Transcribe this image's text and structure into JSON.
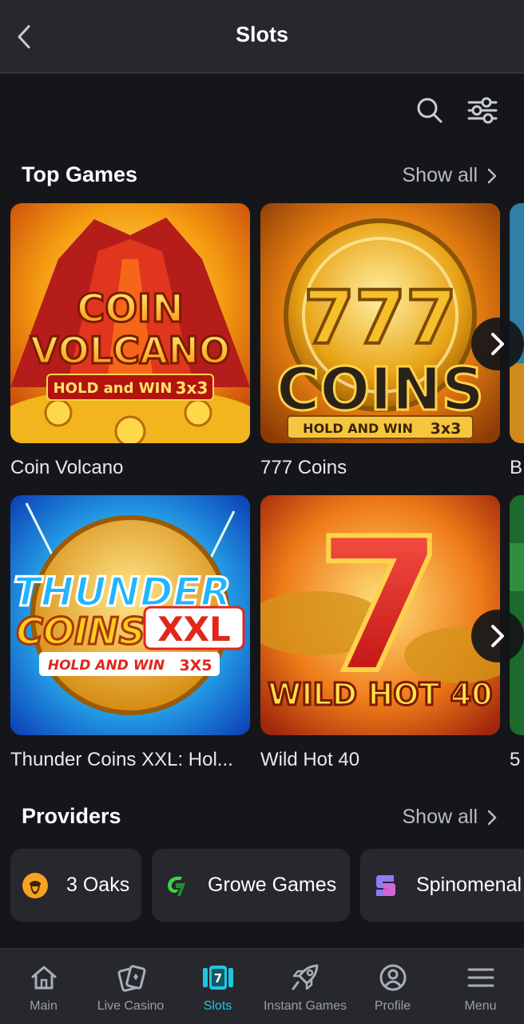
{
  "header": {
    "title": "Slots"
  },
  "top_games": {
    "title": "Top Games",
    "show_all": "Show all",
    "row1": [
      {
        "name": "Coin Volcano",
        "art_line1": "COIN",
        "art_line2": "VOLCANO",
        "art_line3": "HOLD and WIN",
        "art_badge": "3x3"
      },
      {
        "name": "777 Coins",
        "art_line1": "777",
        "art_line2": "COINS",
        "art_line3": "HOLD AND WIN",
        "art_badge": "3x3"
      }
    ],
    "row1_peek_label": "B",
    "row2": [
      {
        "name": "Thunder Coins XXL: Hol...",
        "art_line1": "THUNDER",
        "art_line2": "COINS",
        "art_line2b": "XXL",
        "art_line3": "HOLD AND WIN",
        "art_badge": "3X5"
      },
      {
        "name": "Wild Hot 40",
        "art_line1": "7",
        "art_line2": "WILD HOT 40"
      }
    ],
    "row2_peek_label": "5"
  },
  "providers": {
    "title": "Providers",
    "show_all": "Show all",
    "items": [
      {
        "name": "3 Oaks",
        "color": "#f4a322"
      },
      {
        "name": "Growe Games",
        "color": "#3fd34a"
      },
      {
        "name": "Spinomenal",
        "color": "#8f7cf5"
      }
    ]
  },
  "nav": {
    "items": [
      {
        "label": "Main",
        "icon": "home-icon"
      },
      {
        "label": "Live Casino",
        "icon": "cards-icon"
      },
      {
        "label": "Slots",
        "icon": "slot-machine-icon",
        "active": true
      },
      {
        "label": "Instant Games",
        "icon": "rocket-icon"
      },
      {
        "label": "Profile",
        "icon": "user-icon"
      },
      {
        "label": "Menu",
        "icon": "hamburger-icon"
      }
    ]
  },
  "colors": {
    "accent": "#21c6e0",
    "background": "#151619",
    "surface": "#26282d"
  }
}
